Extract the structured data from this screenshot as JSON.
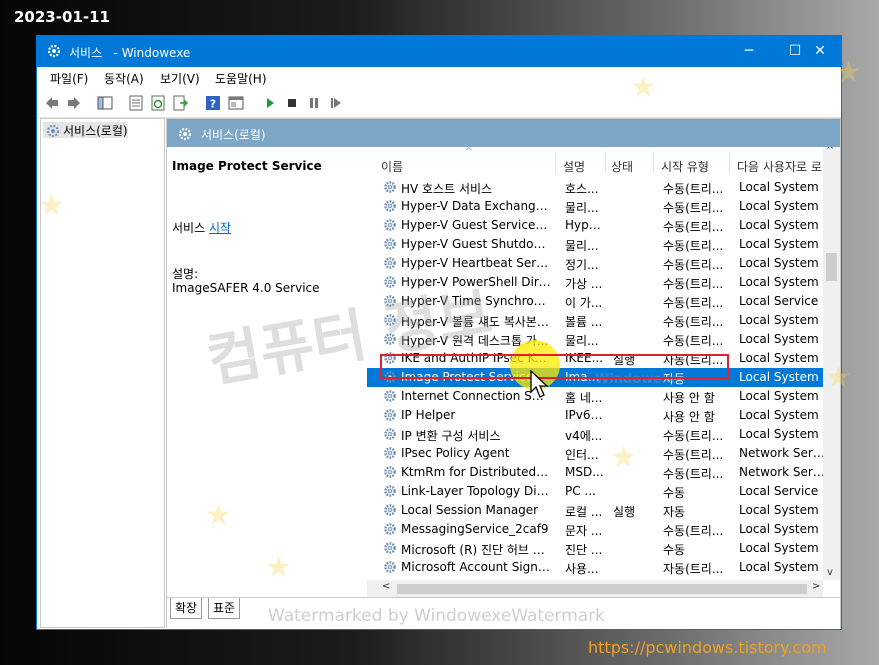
{
  "overlay": {
    "date": "2023-01-11",
    "site_url": "https://pcwindows.tistory.com",
    "watermark_center": "컴퓨터 정보",
    "watermark_small": "Windowexe",
    "watermark_bottom": "Watermarked by WindowexeWatermark"
  },
  "window": {
    "title": "서비스   - Windowexe",
    "minimize": "─",
    "maximize": "☐",
    "close": "✕"
  },
  "menu": [
    "파일(F)",
    "동작(A)",
    "보기(V)",
    "도움말(H)"
  ],
  "toolbar_icons": [
    "back-arrow-icon",
    "forward-arrow-icon",
    "show-hide-tree-icon",
    "properties-icon",
    "refresh-icon",
    "export-icon",
    "help-icon",
    "console-icon",
    "start-icon",
    "stop-icon",
    "pause-icon",
    "restart-icon"
  ],
  "tree": {
    "item": "서비스(로컬)"
  },
  "content_header": "서비스(로컬)",
  "details": {
    "service_name": "Image Protect Service",
    "action_prefix": "서비스 ",
    "action_link": "시작",
    "desc_label": "설명:",
    "desc_value": "ImageSAFER 4.0 Service"
  },
  "columns": [
    "이름",
    "설명",
    "상태",
    "시작 유형",
    "다음 사용자로 로"
  ],
  "rows": [
    {
      "name": "HV 호스트 서비스",
      "desc": "호스...",
      "status": "",
      "startup": "수동(트리...",
      "logon": "Local System"
    },
    {
      "name": "Hyper-V Data Exchange Se...",
      "desc": "물리...",
      "status": "",
      "startup": "수동(트리...",
      "logon": "Local System"
    },
    {
      "name": "Hyper-V Guest Service Inte...",
      "desc": "Hype...",
      "status": "",
      "startup": "수동(트리...",
      "logon": "Local System"
    },
    {
      "name": "Hyper-V Guest Shutdown ...",
      "desc": "물리...",
      "status": "",
      "startup": "수동(트리...",
      "logon": "Local System"
    },
    {
      "name": "Hyper-V Heartbeat Service",
      "desc": "정기...",
      "status": "",
      "startup": "수동(트리...",
      "logon": "Local System"
    },
    {
      "name": "Hyper-V PowerShell Direct...",
      "desc": "가상 ...",
      "status": "",
      "startup": "수동(트리...",
      "logon": "Local System"
    },
    {
      "name": "Hyper-V Time Synchroniza...",
      "desc": "이 가...",
      "status": "",
      "startup": "수동(트리...",
      "logon": "Local Service"
    },
    {
      "name": "Hyper-V 볼륨 섀도 복사본 ...",
      "desc": "볼륨 ...",
      "status": "",
      "startup": "수동(트리...",
      "logon": "Local System"
    },
    {
      "name": "Hyper-V 원격 데스크톱 가...",
      "desc": "물리...",
      "status": "",
      "startup": "수동(트리...",
      "logon": "Local System"
    },
    {
      "name": "IKE and AuthIP IPsec Keyin...",
      "desc": "IKEE...",
      "status": "실행",
      "startup": "자동(트리...",
      "logon": "Local System"
    },
    {
      "name": "Image Protect Service",
      "desc": "Imag...",
      "status": "",
      "startup": "자동",
      "logon": "Local System",
      "selected": true
    },
    {
      "name": "Internet Connection Sha...",
      "desc": "홈 네...",
      "status": "",
      "startup": "사용 안 함",
      "logon": "Local System"
    },
    {
      "name": "IP Helper",
      "desc": "IPv6 ...",
      "status": "",
      "startup": "사용 안 함",
      "logon": "Local System"
    },
    {
      "name": "IP 변환 구성 서비스",
      "desc": "v4에...",
      "status": "",
      "startup": "수동(트리...",
      "logon": "Local System"
    },
    {
      "name": "IPsec Policy Agent",
      "desc": "인터...",
      "status": "",
      "startup": "수동(트리...",
      "logon": "Network Service"
    },
    {
      "name": "KtmRm for Distributed Tra...",
      "desc": "MSD...",
      "status": "",
      "startup": "수동(트리...",
      "logon": "Network Service"
    },
    {
      "name": "Link-Layer Topology Disco...",
      "desc": "PC ...",
      "status": "",
      "startup": "수동",
      "logon": "Local Service"
    },
    {
      "name": "Local Session Manager",
      "desc": "로컬 ...",
      "status": "실행",
      "startup": "자동",
      "logon": "Local System"
    },
    {
      "name": "MessagingService_2caf9",
      "desc": "문자 ...",
      "status": "",
      "startup": "수동(트리...",
      "logon": "Local System"
    },
    {
      "name": "Microsoft (R) 진단 허브 표...",
      "desc": "진단 ...",
      "status": "",
      "startup": "수동",
      "logon": "Local System"
    },
    {
      "name": "Microsoft Account Sign-in ...",
      "desc": "사용...",
      "status": "",
      "startup": "자동(트리...",
      "logon": "Local System"
    }
  ],
  "tabs": [
    "확장",
    "표준"
  ],
  "colors": {
    "titlebar": "#0078d7",
    "selection": "#0078d7",
    "content_header": "#7ea6c7",
    "highlight_box": "#e0202c"
  }
}
